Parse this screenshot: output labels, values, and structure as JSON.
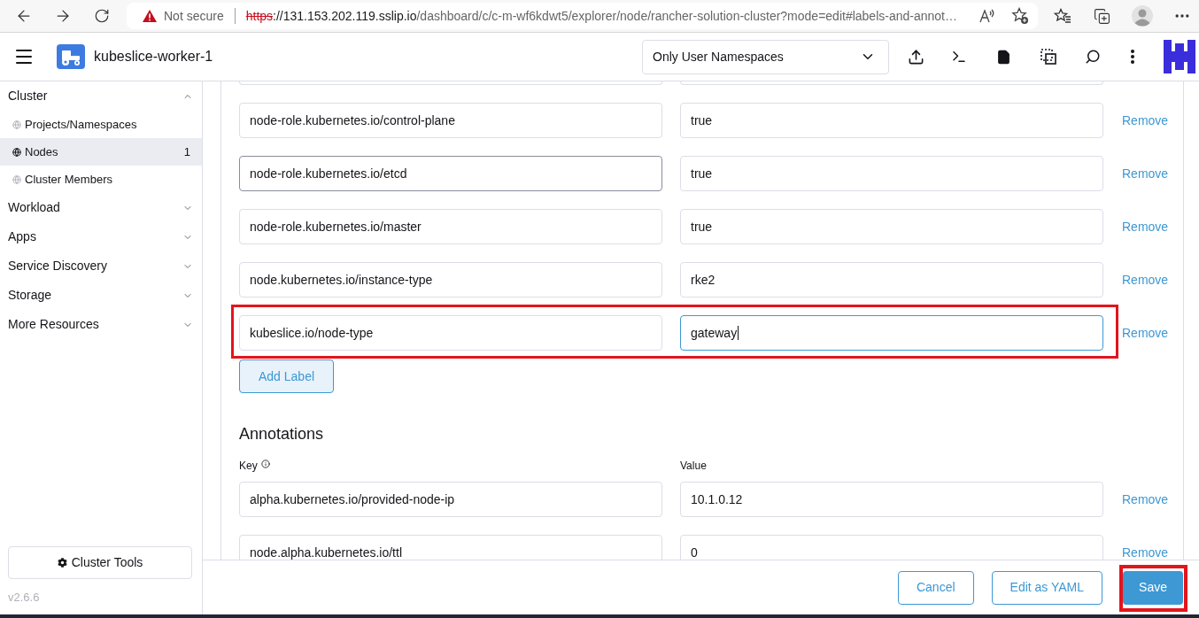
{
  "browser": {
    "security_label": "Not secure",
    "url": {
      "scheme": "https",
      "host": "://131.153.202.119.sslip.io",
      "path": "/dashboard/c/c-m-wf6kdwt5/explorer/node/rancher-solution-cluster?mode=edit#labels-and-annot…"
    }
  },
  "header": {
    "cluster_name": "kubeslice-worker-1",
    "namespace_filter": "Only User Namespaces"
  },
  "sidebar": {
    "groups": [
      {
        "label": "Cluster",
        "expanded": true,
        "children": [
          {
            "label": "Projects/Namespaces",
            "selected": false
          },
          {
            "label": "Nodes",
            "count": "1",
            "selected": true
          },
          {
            "label": "Cluster Members",
            "selected": false
          }
        ]
      },
      {
        "label": "Workload",
        "expanded": false
      },
      {
        "label": "Apps",
        "expanded": false
      },
      {
        "label": "Service Discovery",
        "expanded": false
      },
      {
        "label": "Storage",
        "expanded": false
      },
      {
        "label": "More Resources",
        "expanded": false
      }
    ],
    "tools_button": "Cluster Tools",
    "version": "v2.6.6"
  },
  "labels": {
    "rows": [
      {
        "key": "node-role.kubernetes.io/control-plane",
        "value": "true",
        "remove": "Remove",
        "key_hovered": false,
        "value_focused": false,
        "highlighted": false
      },
      {
        "key": "node-role.kubernetes.io/etcd",
        "value": "true",
        "remove": "Remove",
        "key_hovered": true,
        "value_focused": false,
        "highlighted": false
      },
      {
        "key": "node-role.kubernetes.io/master",
        "value": "true",
        "remove": "Remove",
        "key_hovered": false,
        "value_focused": false,
        "highlighted": false
      },
      {
        "key": "node.kubernetes.io/instance-type",
        "value": "rke2",
        "remove": "Remove",
        "key_hovered": false,
        "value_focused": false,
        "highlighted": false
      },
      {
        "key": "kubeslice.io/node-type",
        "value": "gateway",
        "remove": "Remove",
        "key_hovered": false,
        "value_focused": true,
        "highlighted": true
      }
    ],
    "add_button": "Add Label"
  },
  "annotations": {
    "title": "Annotations",
    "key_label": "Key",
    "value_label": "Value",
    "rows": [
      {
        "key": "alpha.kubernetes.io/provided-node-ip",
        "value": "10.1.0.12",
        "remove": "Remove"
      },
      {
        "key": "node.alpha.kubernetes.io/ttl",
        "value": "0",
        "remove": "Remove"
      }
    ]
  },
  "footer": {
    "buttons": [
      {
        "label": "Cancel",
        "kind": "outline",
        "highlighted": false
      },
      {
        "label": "Edit as YAML",
        "kind": "outline",
        "highlighted": false
      },
      {
        "label": "Save",
        "kind": "primary",
        "highlighted": true
      }
    ]
  }
}
